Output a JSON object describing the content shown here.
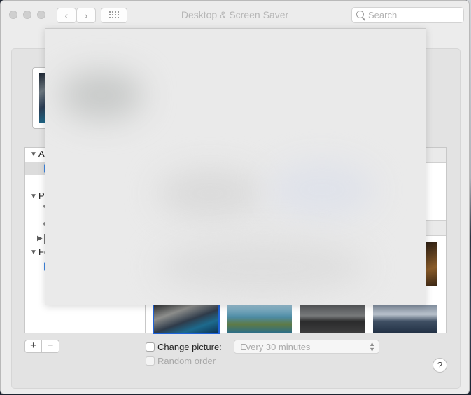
{
  "window": {
    "title": "Desktop & Screen Saver",
    "search_placeholder": "Search",
    "back_glyph": "‹",
    "forward_glyph": "›"
  },
  "sidebar": {
    "sections": [
      {
        "label": "Ap",
        "expanded": true
      },
      {
        "label": "Ph",
        "expanded": true
      },
      {
        "label": "Fo",
        "expanded": true
      }
    ],
    "add_glyph": "+",
    "remove_glyph": "−"
  },
  "options": {
    "change_picture_label": "Change picture:",
    "change_picture_checked": false,
    "interval_value": "Every 30 minutes",
    "random_order_label": "Random order",
    "random_order_checked": false
  },
  "help_glyph": "?",
  "icons": [
    "close-button",
    "minimize-button",
    "zoom-button",
    "back-icon",
    "forward-icon",
    "grid-icon",
    "search-icon",
    "disclosure-triangle-icon",
    "help-icon",
    "stepper-arrows-icon"
  ]
}
